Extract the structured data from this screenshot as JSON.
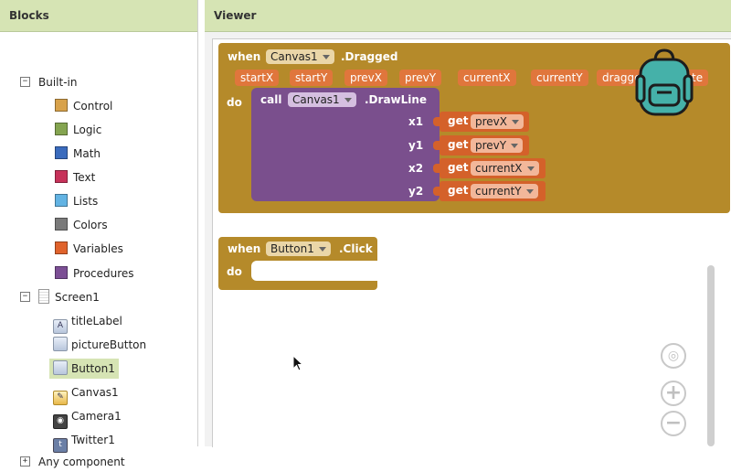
{
  "blocks_panel": {
    "title": "Blocks",
    "built_in": {
      "toggle": "−",
      "label": "Built-in",
      "items": [
        {
          "label": "Control",
          "color": "#d8a24b"
        },
        {
          "label": "Logic",
          "color": "#84a450"
        },
        {
          "label": "Math",
          "color": "#3a6bbd"
        },
        {
          "label": "Text",
          "color": "#c7325a"
        },
        {
          "label": "Lists",
          "color": "#62b3e3"
        },
        {
          "label": "Colors",
          "color": "#7a7a7a"
        },
        {
          "label": "Variables",
          "color": "#e0632c"
        },
        {
          "label": "Procedures",
          "color": "#7c4f95"
        }
      ]
    },
    "screen": {
      "toggle": "−",
      "label": "Screen1",
      "components": [
        {
          "label": "titleLabel",
          "icon": "A",
          "icon_name": "label-icon",
          "selected": false
        },
        {
          "label": "pictureButton",
          "icon": "",
          "icon_name": "button-icon",
          "selected": false
        },
        {
          "label": "Button1",
          "icon": "",
          "icon_name": "button-icon",
          "selected": true
        },
        {
          "label": "Canvas1",
          "icon": "✎",
          "icon_name": "canvas-icon",
          "selected": false
        },
        {
          "label": "Camera1",
          "icon": "◉",
          "icon_name": "camera-icon",
          "selected": false
        },
        {
          "label": "Twitter1",
          "icon": "t",
          "icon_name": "twitter-icon",
          "selected": false
        }
      ]
    },
    "any_component": {
      "toggle": "+",
      "label": "Any component"
    }
  },
  "viewer": {
    "title": "Viewer",
    "dragged_block": {
      "when": "when",
      "component": "Canvas1",
      "event": ".Dragged",
      "params": [
        "startX",
        "startY",
        "prevX",
        "prevY",
        "currentX",
        "currentY",
        "dragge",
        "te"
      ],
      "do": "do",
      "call": {
        "call": "call",
        "component": "Canvas1",
        "method": ".DrawLine",
        "args": [
          {
            "name": "x1",
            "get": "get",
            "var": "prevX"
          },
          {
            "name": "y1",
            "get": "get",
            "var": "prevY"
          },
          {
            "name": "x2",
            "get": "get",
            "var": "currentX"
          },
          {
            "name": "y2",
            "get": "get",
            "var": "currentY"
          }
        ]
      }
    },
    "click_block": {
      "when": "when",
      "component": "Button1",
      "event": ".Click",
      "do": "do"
    },
    "zoom": {
      "plus": "+",
      "minus": "−"
    }
  },
  "colors": {
    "header_bg": "#d6e4b4",
    "event_block": "#b58a2a",
    "call_block": "#7a4f8d",
    "get_block": "#d4612a"
  }
}
